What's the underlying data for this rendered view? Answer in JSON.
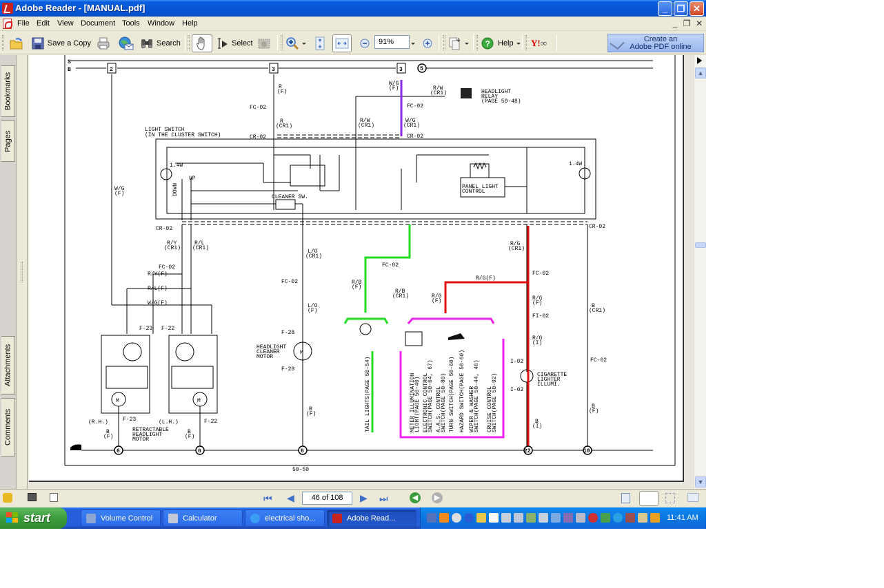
{
  "window": {
    "title": "Adobe Reader - [MANUAL.pdf]",
    "controls": {
      "minimize": "_",
      "restore": "❐",
      "close": "✕"
    },
    "doc_controls": {
      "minimize": "_",
      "restore": "❐",
      "close": "✕"
    }
  },
  "menu": [
    "File",
    "Edit",
    "View",
    "Document",
    "Tools",
    "Window",
    "Help"
  ],
  "toolbar": {
    "save_copy": "Save a Copy",
    "search": "Search",
    "select": "Select",
    "zoom_value": "91%",
    "help": "Help",
    "create_pdf_line1": "Create an",
    "create_pdf_line2": "Adobe PDF online"
  },
  "nav_tabs": [
    "Bookmarks",
    "Pages",
    "Attachments",
    "Comments"
  ],
  "status": {
    "page_field": "46 of 108"
  },
  "diagram": {
    "page_number": "50-50",
    "bus_labels": [
      "S",
      "B"
    ],
    "fuse_refs": [
      "2",
      "3",
      "3",
      "5"
    ],
    "light_switch": [
      "LIGHT SWITCH",
      "(IN THE CLUSTER SWITCH)"
    ],
    "headlight_relay": [
      "HEADLIGHT",
      "RELAY",
      "(PAGE 50-48)"
    ],
    "panel_light_control": [
      "PANEL LIGHT",
      "CONTROL"
    ],
    "cleaner_sw": "CLEANER SW.",
    "bulb_watt_left": "1.4W",
    "bulb_watt_right": "1.4W",
    "up": "UP",
    "down": "DOWN",
    "connectors": {
      "fc02": "FC-02",
      "cr02": "CR-02",
      "f23": "F-23",
      "f22": "F-22",
      "f28": "F-28",
      "fi02": "FI-02",
      "i02": "I-02"
    },
    "wire_labels": {
      "r_f": [
        "R",
        "(F)"
      ],
      "r_cr1": [
        "R",
        "(CR1)"
      ],
      "wg_f": [
        "W/G",
        "(F)"
      ],
      "wg_cr1": [
        "W/G",
        "(CR1)"
      ],
      "rw_cr1": [
        "R/W",
        "(CR1)"
      ],
      "ry_cr1": [
        "R/Y",
        "(CR1)"
      ],
      "rl_cr1": [
        "R/L",
        "(CR1)"
      ],
      "ry_f": "R/Y(F)",
      "rl_f": "R/L(F)",
      "wg_f_h": "W/G(F)",
      "lo_cr1": [
        "L/O",
        "(CR1)"
      ],
      "lo_f": [
        "L/O",
        "(F)"
      ],
      "rb_cr1": [
        "R/B",
        "(CR1)"
      ],
      "rb_f": [
        "R/B",
        "(F)"
      ],
      "rg_cr1": [
        "R/G",
        "(CR1)"
      ],
      "rg_f_h": "R/G(F)",
      "rg_f": [
        "R/G",
        "(F)"
      ],
      "rg_i": [
        "R/G",
        "(I)"
      ],
      "b_f": [
        "B",
        "(F)"
      ],
      "b_cr1": [
        "B",
        "(CR1)"
      ],
      "b_i": [
        "B",
        "(I)"
      ]
    },
    "rh": "(R.H.)",
    "lh": "(L.H.)",
    "retractable_motor": [
      "RETRACTABLE",
      "HEADLIGHT",
      "MOTOR"
    ],
    "cleaner_motor": [
      "HEADLIGHT",
      "CLEANER",
      "MOTOR"
    ],
    "motor_symbol": "M",
    "tail_lights": "TAIL LIGHTS(PAGE 50-54)",
    "switch_list": [
      [
        "METER ILLUMINATION",
        "LIGHT(PAGE 50-40)"
      ],
      [
        "ELECTRONIC CONTROL",
        "SWITCH(PAGE 50-64, 67)"
      ],
      [
        "A.A.S. CONTROL",
        "SWITCH(PAGE 50-80)"
      ],
      [
        "TURN SWITCH(PAGE 50-60)"
      ],
      [
        "HAZARD SWITCH(PAGE 50-60)"
      ],
      [
        "WIPER & WASHER",
        "SWITCH(PAGE 50-44, 46)"
      ],
      [
        "CRUISE CONTROL",
        "SWITCH(PAGE 50-92)"
      ]
    ],
    "cigarette": [
      "CIGARETTE",
      "LIGHTER",
      "ILLUMI."
    ],
    "ground_refs": [
      "6",
      "6",
      "6",
      "22",
      "10"
    ],
    "highlight_colors": {
      "purple": "#8a2be2",
      "green": "#22dd22",
      "red": "#e01010",
      "magenta": "#ee22ee"
    }
  },
  "taskbar": {
    "start": "start",
    "tasks": [
      "Volume Control",
      "Calculator",
      "electrical sho...",
      "Adobe Read..."
    ],
    "clock": "11:41 AM"
  }
}
